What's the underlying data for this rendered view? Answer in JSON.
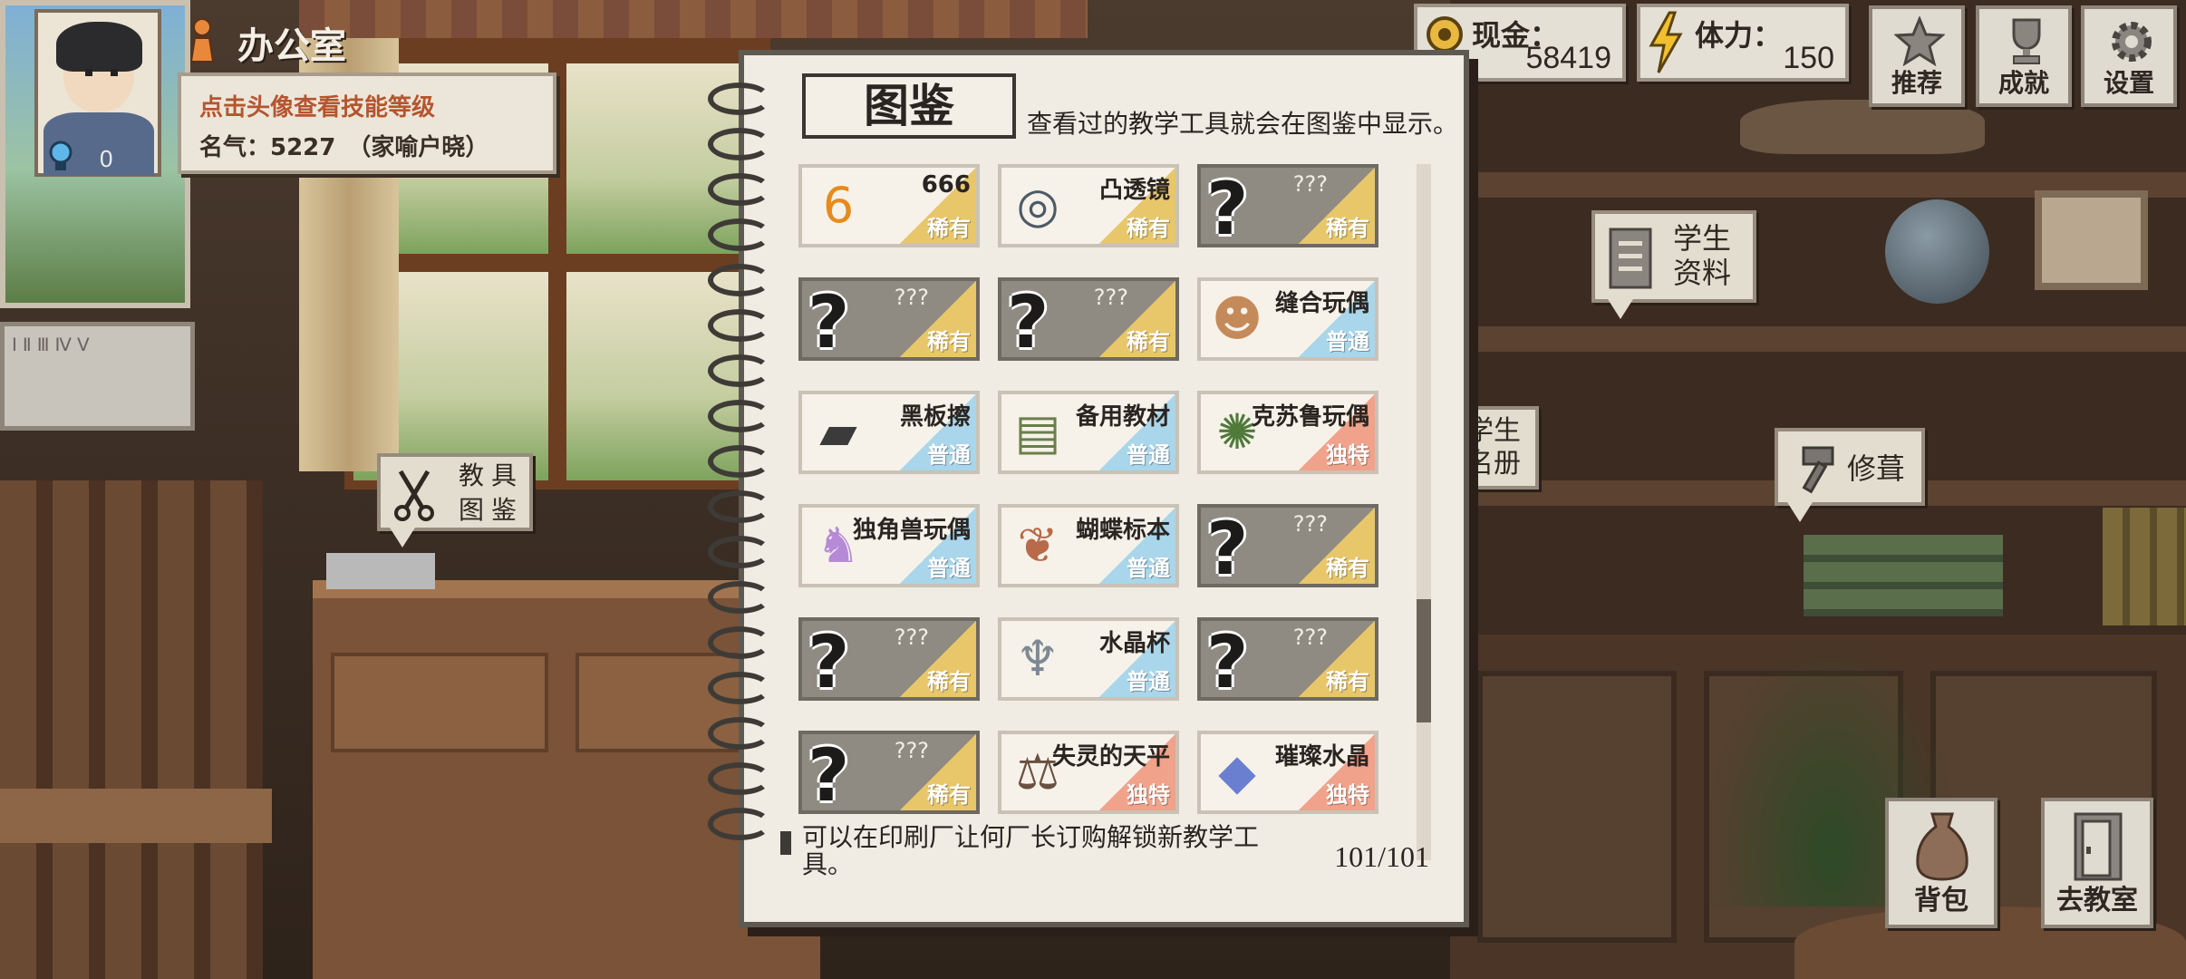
{
  "location": {
    "name": "办公室"
  },
  "player": {
    "hint": "点击头像查看技能等级",
    "fame": "名气：5227　（家喻户晓）",
    "skill_points": "0"
  },
  "stats": {
    "cash_label": "现金：",
    "cash_value": "58419",
    "stamina_label": "体力：",
    "stamina_value": "150"
  },
  "top_buttons": [
    {
      "label": "推荐",
      "icon": "star-icon"
    },
    {
      "label": "成就",
      "icon": "trophy-icon"
    },
    {
      "label": "设置",
      "icon": "gear-icon"
    }
  ],
  "bubbles": {
    "student_info": "学生\n资料",
    "roster": "学生\n名册",
    "repair": "修葺",
    "tool_catalog_1": "教具",
    "tool_catalog_2": "图鉴"
  },
  "bottom_buttons": [
    {
      "label": "背包",
      "icon": "bag-icon"
    },
    {
      "label": "去教室",
      "icon": "door-icon"
    }
  ],
  "catalog": {
    "title": "图鉴",
    "subtitle": "查看过的教学工具就会在图鉴中显示。",
    "footer": "可以在印刷厂让何厂长订购解锁新教学工具。",
    "count": "101/101",
    "rarity_colors": {
      "稀有": "#e8c66a",
      "普通": "#a9d6ea",
      "独特": "#f0a28a"
    },
    "items": [
      {
        "name": "666",
        "rarity": "稀有",
        "locked": false,
        "icon": "666-icon"
      },
      {
        "name": "凸透镜",
        "rarity": "稀有",
        "locked": false,
        "icon": "lens-icon"
      },
      {
        "name": "???",
        "rarity": "稀有",
        "locked": true,
        "icon": "question-icon"
      },
      {
        "name": "???",
        "rarity": "稀有",
        "locked": true,
        "icon": "question-icon"
      },
      {
        "name": "???",
        "rarity": "稀有",
        "locked": true,
        "icon": "question-icon"
      },
      {
        "name": "缝合玩偶",
        "rarity": "普通",
        "locked": false,
        "icon": "doll-icon"
      },
      {
        "name": "黑板擦",
        "rarity": "普通",
        "locked": false,
        "icon": "eraser-icon"
      },
      {
        "name": "备用教材",
        "rarity": "普通",
        "locked": false,
        "icon": "book-icon"
      },
      {
        "name": "克苏鲁玩偶",
        "rarity": "独特",
        "locked": false,
        "icon": "cthulhu-icon"
      },
      {
        "name": "独角兽玩偶",
        "rarity": "普通",
        "locked": false,
        "icon": "unicorn-icon"
      },
      {
        "name": "蝴蝶标本",
        "rarity": "普通",
        "locked": false,
        "icon": "butterfly-icon"
      },
      {
        "name": "???",
        "rarity": "稀有",
        "locked": true,
        "icon": "question-icon"
      },
      {
        "name": "???",
        "rarity": "稀有",
        "locked": true,
        "icon": "question-icon"
      },
      {
        "name": "水晶杯",
        "rarity": "普通",
        "locked": false,
        "icon": "goblet-icon"
      },
      {
        "name": "???",
        "rarity": "稀有",
        "locked": true,
        "icon": "question-icon"
      },
      {
        "name": "???",
        "rarity": "稀有",
        "locked": true,
        "icon": "question-icon"
      },
      {
        "name": "失灵的天平",
        "rarity": "独特",
        "locked": false,
        "icon": "scale-icon"
      },
      {
        "name": "璀璨水晶",
        "rarity": "独特",
        "locked": false,
        "icon": "crystal-icon"
      }
    ]
  }
}
